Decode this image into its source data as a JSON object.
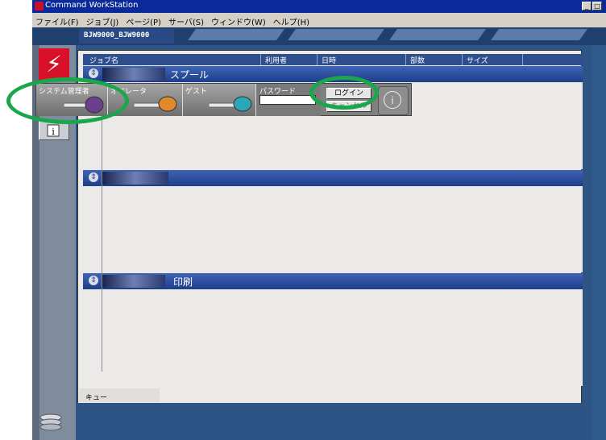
{
  "window": {
    "title": "Command WorkStation",
    "controls": [
      "_",
      "□",
      "×"
    ]
  },
  "menubar": {
    "items": [
      "ファイル(F)",
      "ジョブ(J)",
      "ページ(P)",
      "サーバ(S)",
      "ウィンドウ(W)",
      "ヘルプ(H)"
    ]
  },
  "server_tab": {
    "label": "BJW9000_BJW9000"
  },
  "columns": [
    "ジョブ名",
    "利用者",
    "日時",
    "部数",
    "サイズ"
  ],
  "sections": {
    "spool": {
      "title": "スプール"
    },
    "hold": {
      "title": ""
    },
    "print": {
      "title": "印刷"
    }
  },
  "login": {
    "roles": [
      {
        "label": "システム管理者",
        "key_color": "#6a3f8e"
      },
      {
        "label": "オペレータ",
        "key_color": "#e08a2c"
      },
      {
        "label": "ゲスト",
        "key_color": "#2aa6b8"
      }
    ],
    "password_label": "パスワード",
    "password_value": "",
    "login_button": "ログイン",
    "cancel_button": "キャンセル",
    "info_icon": "info-icon"
  },
  "queue_tab": {
    "label": "キュー"
  },
  "highlight_color": "#1aa64a"
}
